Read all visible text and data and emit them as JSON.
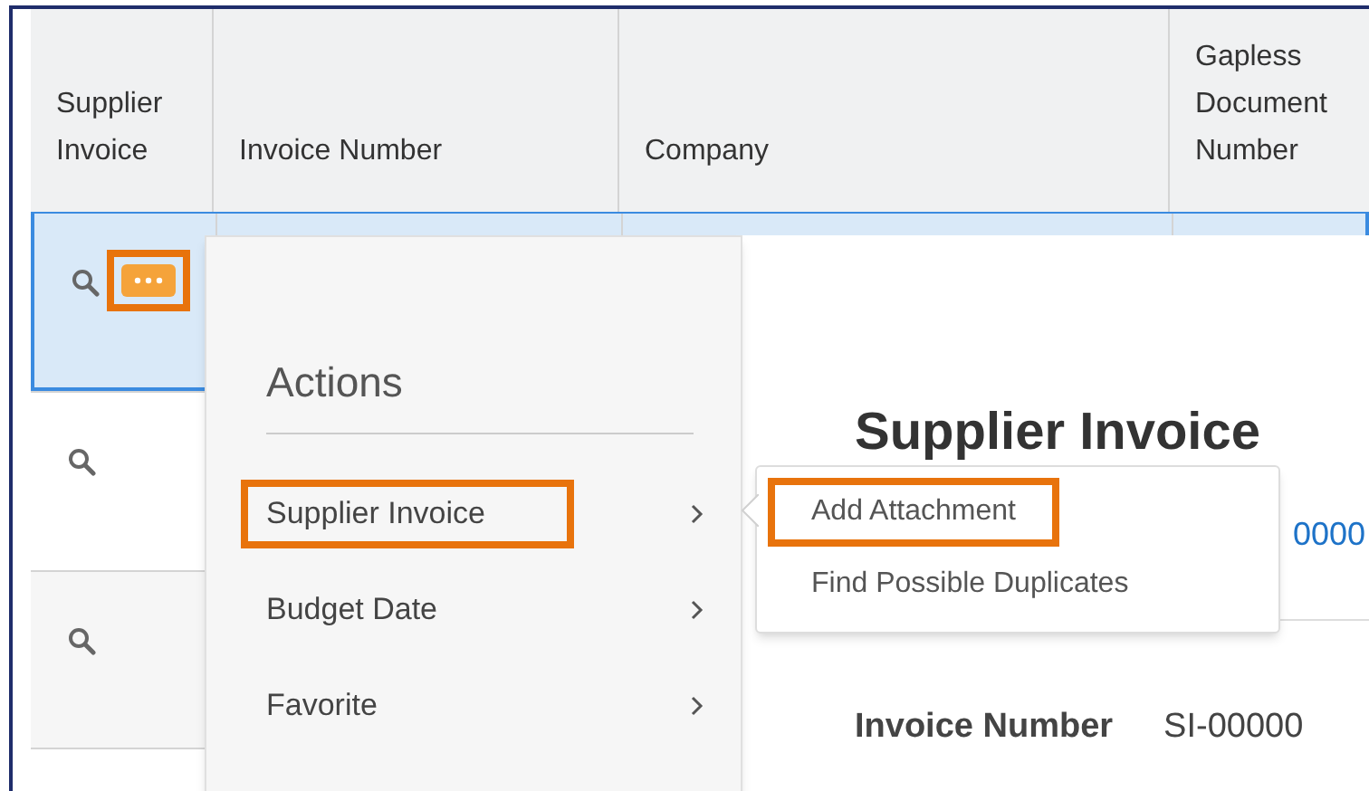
{
  "table": {
    "columns": [
      "Supplier Invoice",
      "Invoice Number",
      "Company",
      "Gapless Document Number"
    ],
    "rows": [
      {
        "selected": true,
        "search_icon": true,
        "actions_button": {
          "highlighted": true
        }
      },
      {
        "selected": false,
        "search_icon": true
      },
      {
        "selected": false,
        "search_icon": true
      },
      {
        "selected": false,
        "search_icon": false
      }
    ]
  },
  "actions_menu": {
    "title": "Actions",
    "items": [
      {
        "label": "Supplier Invoice",
        "highlighted": true
      },
      {
        "label": "Budget Date",
        "highlighted": false
      },
      {
        "label": "Favorite",
        "highlighted": false
      }
    ]
  },
  "submenu": {
    "items": [
      {
        "label": "Add Attachment",
        "highlighted": true
      },
      {
        "label": "Find Possible Duplicates",
        "highlighted": false
      }
    ]
  },
  "details": {
    "title": "Supplier Invoice",
    "link": "0000",
    "fields": [
      {
        "label": "Invoice Number",
        "value": "SI-00000"
      }
    ]
  }
}
